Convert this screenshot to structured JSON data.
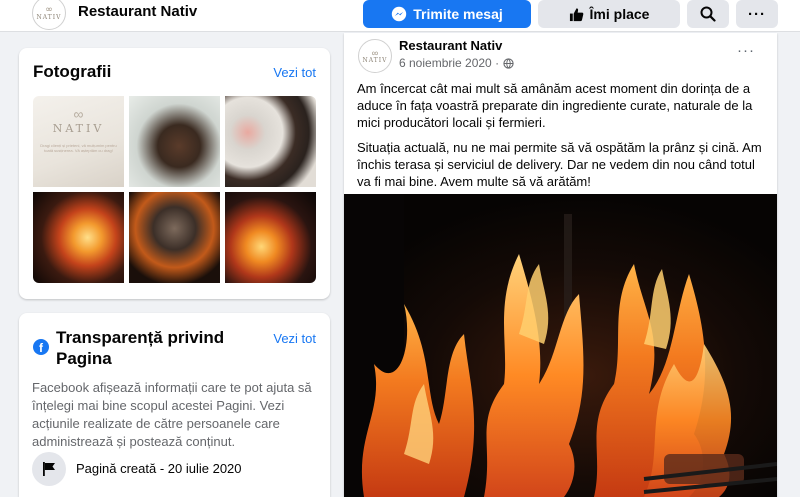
{
  "header": {
    "page_name": "Restaurant Nativ",
    "logo_text": "NATIV",
    "message_button": "Trimite mesaj",
    "like_button": "Îmi place",
    "more_button": "···"
  },
  "photos": {
    "title": "Fotografii",
    "see_all": "Vezi tot",
    "card_text": "Dragi clienți și prieteni, vă mulțumim pentru toată susținerea. Vă așteptăm cu drag!",
    "thumbnails": [
      "nativ-announcement",
      "steak-cutting",
      "steak-board",
      "grill-steaks",
      "meat-on-fire",
      "flames-grill"
    ]
  },
  "transparency": {
    "title": "Transparență privind Pagina",
    "see_all": "Vezi tot",
    "description": "Facebook afișează informații care te pot ajuta să înțelegi mai bine scopul acestei Pagini. Vezi acțiunile realizate de către persoanele care administrează și postează conținut.",
    "created": "Pagină creată - 20 iulie 2020"
  },
  "post": {
    "author": "Restaurant Nativ",
    "date": "6 noiembrie 2020 ·",
    "more": "···",
    "paragraph1": "Am încercat cât mai mult să amânăm acest moment din dorința de a aduce în fața voastră preparate din ingrediente curate, naturale de la mici producători locali și fermieri.",
    "paragraph2": "Situația actuală, nu ne mai permite să vă ospătăm la prânz și cină. Am închis terasa și serviciul de delivery. Dar ne vedem din nou când totul va fi mai bine. Avem multe să vă arătăm!"
  },
  "colors": {
    "accent": "#1877f2",
    "background": "#f0f2f5",
    "secondary_text": "#65676b"
  }
}
